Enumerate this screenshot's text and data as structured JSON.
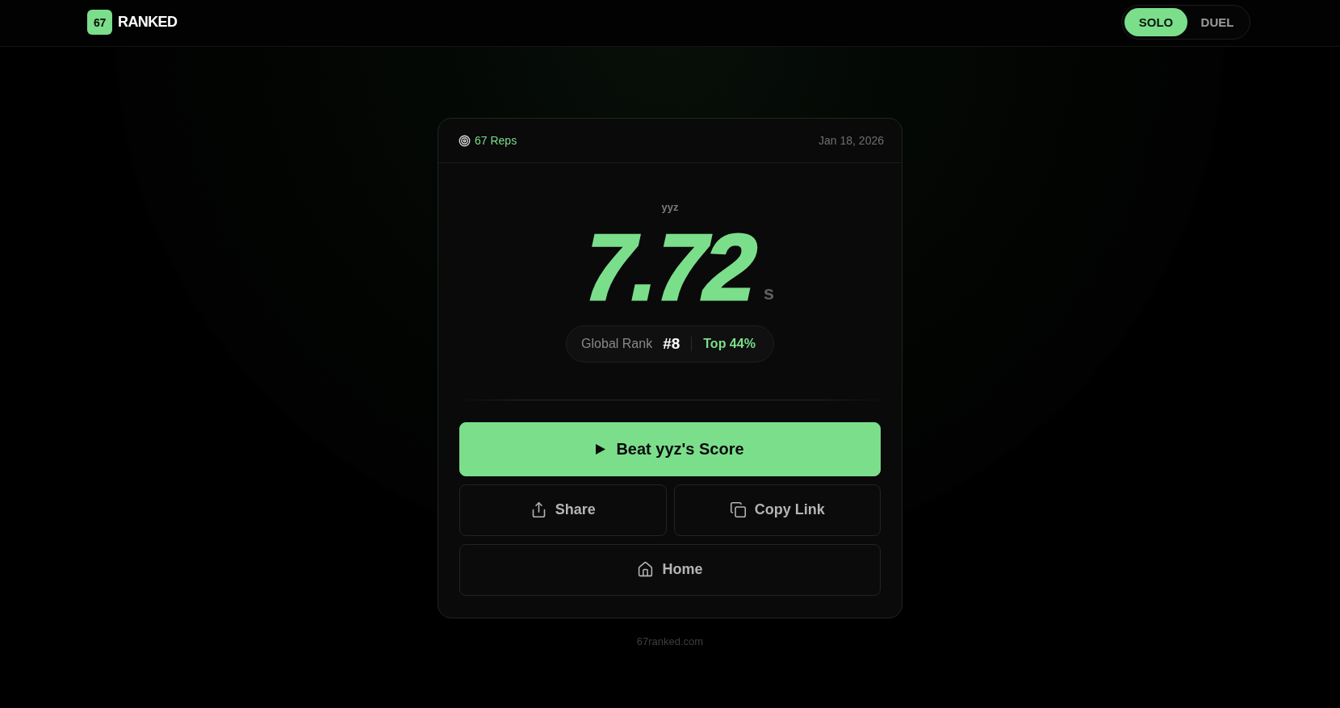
{
  "header": {
    "logo": {
      "badge": "67",
      "name": "RANKED"
    },
    "mode_toggle": [
      {
        "label": "SOLO",
        "selected": true
      },
      {
        "label": "DUEL",
        "selected": false
      }
    ]
  },
  "result_card": {
    "category": "67 Reps",
    "date": "Jan 18, 2026",
    "player": "yyz",
    "score": "7.72",
    "unit": "s",
    "rank": {
      "label": "Global Rank",
      "value": "#8",
      "percentile": "Top 44%"
    },
    "action_rows": [
      [
        {
          "kind": "primary",
          "label": "Beat yyz's Score"
        }
      ],
      [
        {
          "kind": "share",
          "label": "Share"
        },
        {
          "kind": "copy",
          "label": "Copy Link"
        }
      ],
      [
        {
          "kind": "home",
          "label": "Home"
        }
      ]
    ]
  },
  "footer": {
    "site": "67ranked.com"
  }
}
